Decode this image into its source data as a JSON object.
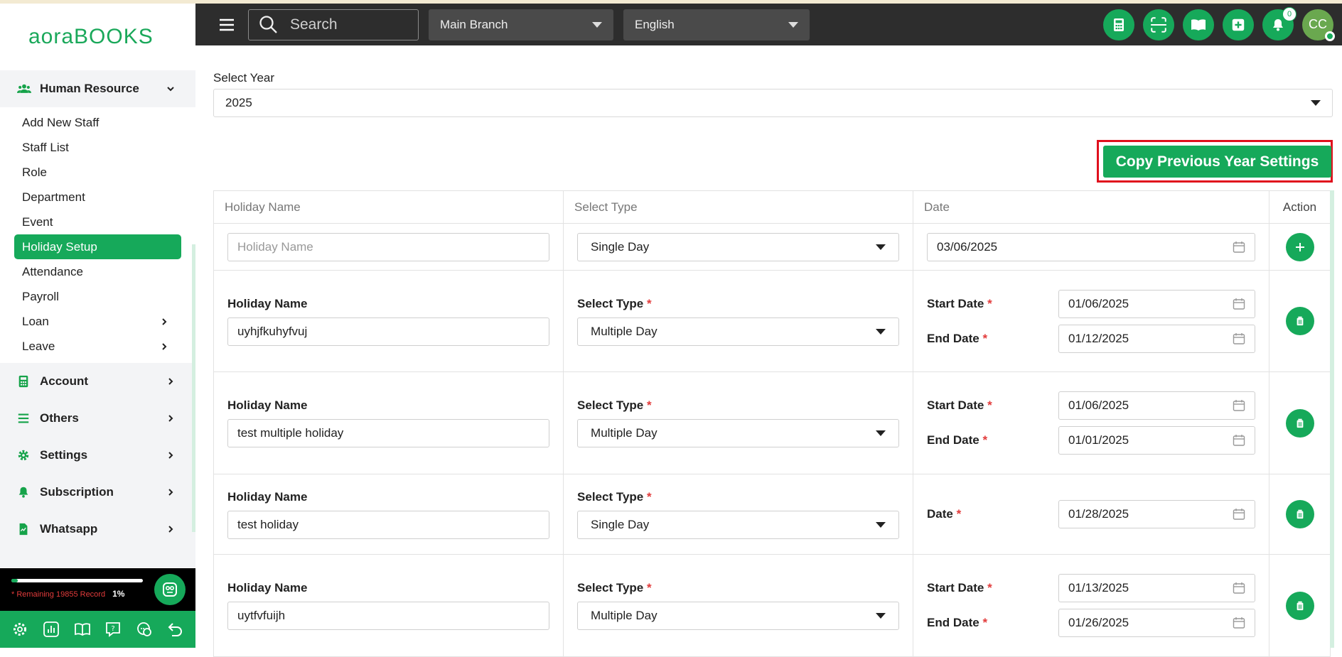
{
  "brand": {
    "logo_left": "aora",
    "logo_right": "BOOKS"
  },
  "topbar": {
    "search_placeholder": "Search",
    "branch": "Main Branch",
    "language": "English",
    "notification_count": "0",
    "avatar_initials": "CC"
  },
  "sidebar": {
    "group_hr": "Human Resource",
    "hr_items": [
      {
        "label": "Add New Staff"
      },
      {
        "label": "Staff List"
      },
      {
        "label": "Role"
      },
      {
        "label": "Department"
      },
      {
        "label": "Event"
      },
      {
        "label": "Holiday Setup",
        "active": true
      },
      {
        "label": "Attendance"
      },
      {
        "label": "Payroll"
      },
      {
        "label": "Loan"
      },
      {
        "label": "Leave"
      }
    ],
    "groups": [
      {
        "label": "Account"
      },
      {
        "label": "Others"
      },
      {
        "label": "Settings"
      },
      {
        "label": "Subscription"
      },
      {
        "label": "Whatsapp"
      }
    ],
    "quota_text": "* Remaining 19855 Record",
    "quota_pct": "1%",
    "quota_fraction": 0.01
  },
  "page": {
    "select_year_label": "Select Year",
    "year": "2025",
    "copy_button": "Copy Previous Year Settings",
    "columns": {
      "name": "Holiday Name",
      "type": "Select Type",
      "date": "Date",
      "action": "Action"
    },
    "new_row": {
      "name_placeholder": "Holiday Name",
      "type": "Single Day",
      "date": "03/06/2025"
    },
    "labels": {
      "holiday_name": "Holiday Name",
      "select_type": "Select Type",
      "start_date": "Start Date",
      "end_date": "End Date",
      "date": "Date",
      "required": "*"
    },
    "holidays": [
      {
        "name": "uyhjfkuhyfvuj",
        "type": "Multiple Day",
        "start": "01/06/2025",
        "end": "01/12/2025"
      },
      {
        "name": "test multiple holiday",
        "type": "Multiple Day",
        "start": "01/06/2025",
        "end": "01/01/2025"
      },
      {
        "name": "test holiday",
        "type": "Single Day",
        "date": "01/28/2025"
      },
      {
        "name": "uytfvfuijh",
        "type": "Multiple Day",
        "start": "01/13/2025",
        "end": "01/26/2025"
      }
    ]
  },
  "colors": {
    "accent": "#16a95a",
    "highlight": "#e0101d",
    "topbar": "#2d2d2d"
  }
}
